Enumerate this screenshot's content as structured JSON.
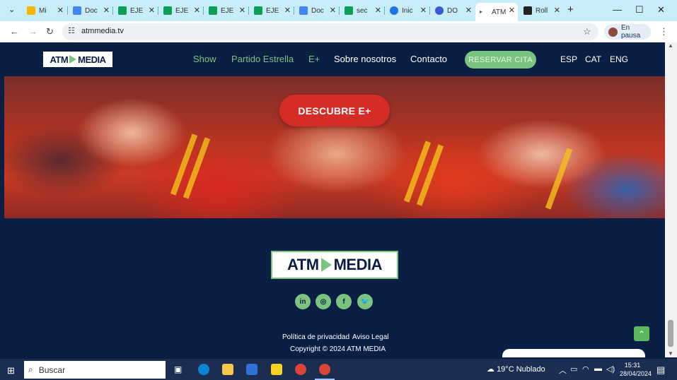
{
  "browser": {
    "tabs": [
      {
        "title": "Mi",
        "icon": "drive-icon",
        "color": "#f4b400"
      },
      {
        "title": "Doc",
        "icon": "docs-icon",
        "color": "#4285f4"
      },
      {
        "title": "EJE",
        "icon": "sheets-icon",
        "color": "#0f9d58"
      },
      {
        "title": "EJE",
        "icon": "sheets-icon",
        "color": "#0f9d58"
      },
      {
        "title": "EJE",
        "icon": "sheets-icon",
        "color": "#0f9d58"
      },
      {
        "title": "EJE",
        "icon": "sheets-icon",
        "color": "#0f9d58"
      },
      {
        "title": "Doc",
        "icon": "docs-icon",
        "color": "#4285f4"
      },
      {
        "title": "sec",
        "icon": "sheets-icon",
        "color": "#0f9d58"
      },
      {
        "title": "Inic",
        "icon": "site-icon",
        "color": "#1a73e8"
      },
      {
        "title": "DO",
        "icon": "chat-icon",
        "color": "#3c5ad6"
      },
      {
        "title": "ATM",
        "icon": "playing-audio-icon",
        "color": "#555555"
      },
      {
        "title": "Roll",
        "icon": "site-icon",
        "color": "#222222"
      }
    ],
    "new_tab": "+",
    "url": "atmmedia.tv",
    "profile_label": "En pausa"
  },
  "site": {
    "brand": {
      "left": "ATM",
      "right": "MEDIA"
    },
    "nav": [
      {
        "label": "Show",
        "color": "#7bc47f"
      },
      {
        "label": "Partido Estrella",
        "color": "#7bc47f"
      },
      {
        "label": "E+",
        "color": "#7bc47f"
      },
      {
        "label": "Sobre nosotros",
        "color": "#ffffff"
      },
      {
        "label": "Contacto",
        "color": "#ffffff"
      }
    ],
    "cta_label": "RESERVAR CITA",
    "languages": [
      "ESP",
      "CAT",
      "ENG"
    ],
    "hero_button": "DESCUBRE E+",
    "social": [
      {
        "name": "linkedin-icon",
        "glyph": "in"
      },
      {
        "name": "instagram-icon",
        "glyph": "◎"
      },
      {
        "name": "facebook-icon",
        "glyph": "f"
      },
      {
        "name": "twitter-icon",
        "glyph": "🐦"
      }
    ],
    "footer_links": [
      "Política de privacidad",
      "Aviso Legal"
    ],
    "copyright": "Copyright © 2024 ATM MEDIA",
    "to_top": "⌃"
  },
  "taskbar": {
    "search_placeholder": "Buscar",
    "weather": "19°C  Nublado",
    "time": "15:31",
    "date": "28/04/2024"
  }
}
